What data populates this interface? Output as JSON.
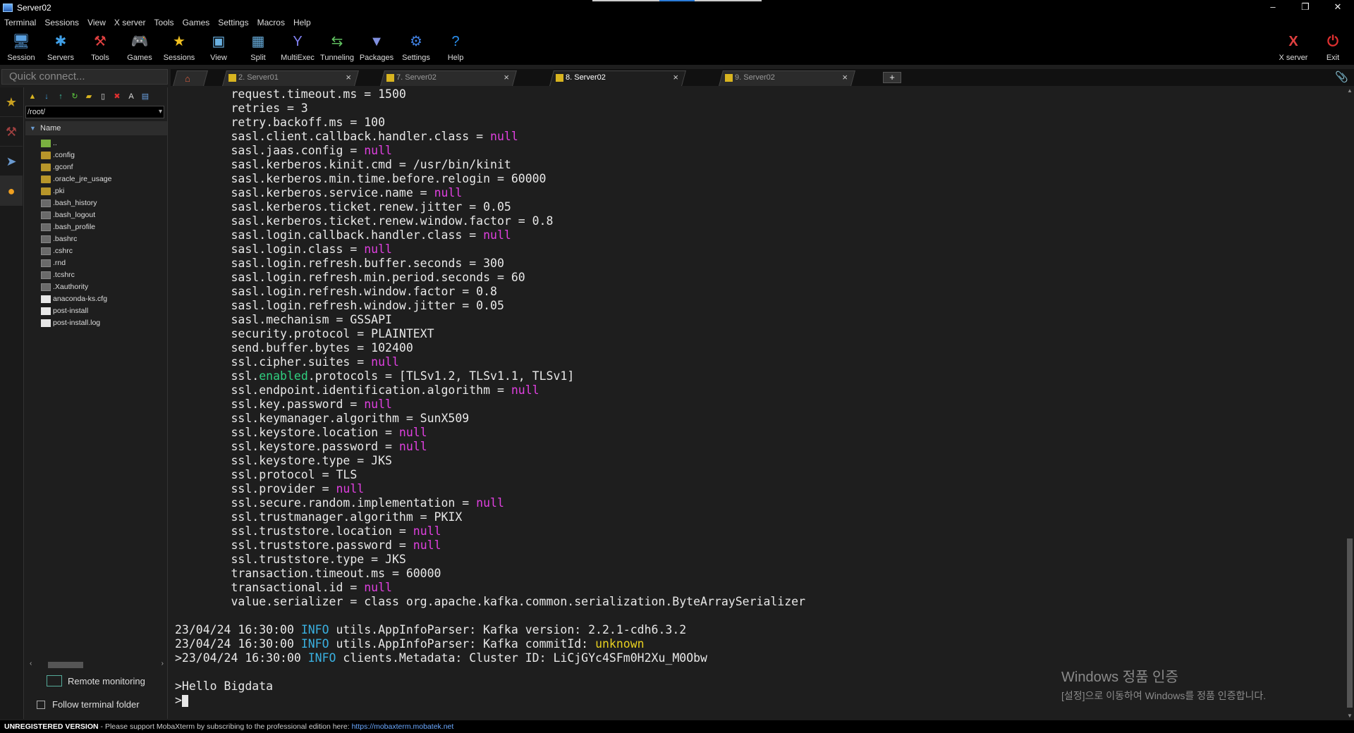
{
  "window": {
    "title": "Server02",
    "controls": [
      "–",
      "❐",
      "✕"
    ]
  },
  "menu": [
    "Terminal",
    "Sessions",
    "View",
    "X server",
    "Tools",
    "Games",
    "Settings",
    "Macros",
    "Help"
  ],
  "toolbar": {
    "items": [
      {
        "label": "Session",
        "icon": "session-icon",
        "glyph": "🖥",
        "color": "#5aa0e0"
      },
      {
        "label": "Servers",
        "icon": "servers-icon",
        "glyph": "✱",
        "color": "#40a0e8"
      },
      {
        "label": "Tools",
        "icon": "tools-icon",
        "glyph": "⚒",
        "color": "#e04040"
      },
      {
        "label": "Games",
        "icon": "games-icon",
        "glyph": "🎮",
        "color": "#ddd"
      },
      {
        "label": "Sessions",
        "icon": "sessions-star-icon",
        "glyph": "★",
        "color": "#f0c020"
      },
      {
        "label": "View",
        "icon": "view-icon",
        "glyph": "▣",
        "color": "#6ab0e0"
      },
      {
        "label": "Split",
        "icon": "split-icon",
        "glyph": "▦",
        "color": "#6ab0e0"
      },
      {
        "label": "MultiExec",
        "icon": "multiexec-icon",
        "glyph": "Y",
        "color": "#8080f0"
      },
      {
        "label": "Tunneling",
        "icon": "tunneling-icon",
        "glyph": "⇆",
        "color": "#60c060"
      },
      {
        "label": "Packages",
        "icon": "packages-icon",
        "glyph": "▼",
        "color": "#8090e0"
      },
      {
        "label": "Settings",
        "icon": "settings-icon",
        "glyph": "⚙",
        "color": "#4080e0"
      },
      {
        "label": "Help",
        "icon": "help-icon",
        "glyph": "?",
        "color": "#2a90f0"
      }
    ],
    "right": [
      {
        "label": "X server",
        "icon": "xserver-icon",
        "glyph": "X",
        "color": "#e04040"
      },
      {
        "label": "Exit",
        "icon": "exit-icon",
        "glyph": "⏻",
        "color": "#e03030"
      }
    ]
  },
  "quick_connect": {
    "placeholder": "Quick connect..."
  },
  "tabs": [
    {
      "label": "2. Server01",
      "active": false
    },
    {
      "label": "7. Server02",
      "active": false
    },
    {
      "label": "8. Server02",
      "active": true
    },
    {
      "label": "9. Server02",
      "active": false
    }
  ],
  "sftp": {
    "path": "/root/",
    "column": "Name",
    "files": [
      {
        "name": "..",
        "kind": "up"
      },
      {
        "name": ".config",
        "kind": "folder"
      },
      {
        "name": ".gconf",
        "kind": "folder"
      },
      {
        "name": ".oracle_jre_usage",
        "kind": "folder"
      },
      {
        "name": ".pki",
        "kind": "folder"
      },
      {
        "name": ".bash_history",
        "kind": "file"
      },
      {
        "name": ".bash_logout",
        "kind": "file"
      },
      {
        "name": ".bash_profile",
        "kind": "file"
      },
      {
        "name": ".bashrc",
        "kind": "file"
      },
      {
        "name": ".cshrc",
        "kind": "file"
      },
      {
        "name": ".rnd",
        "kind": "file"
      },
      {
        "name": ".tcshrc",
        "kind": "file"
      },
      {
        "name": ".Xauthority",
        "kind": "file"
      },
      {
        "name": "anaconda-ks.cfg",
        "kind": "doc"
      },
      {
        "name": "post-install",
        "kind": "doc"
      },
      {
        "name": "post-install.log",
        "kind": "doc"
      }
    ],
    "remote_monitoring": "Remote monitoring",
    "follow_terminal": "Follow terminal folder"
  },
  "terminal_lines": [
    [
      {
        "t": "        request.timeout.ms = 1500"
      }
    ],
    [
      {
        "t": "        retries = 3"
      }
    ],
    [
      {
        "t": "        retry.backoff.ms = 100"
      }
    ],
    [
      {
        "t": "        sasl.client.callback.handler.class = "
      },
      {
        "t": "null",
        "c": "null"
      }
    ],
    [
      {
        "t": "        sasl.jaas.config = "
      },
      {
        "t": "null",
        "c": "null"
      }
    ],
    [
      {
        "t": "        sasl.kerberos.kinit.cmd = /usr/bin/kinit"
      }
    ],
    [
      {
        "t": "        sasl.kerberos.min.time.before.relogin = 60000"
      }
    ],
    [
      {
        "t": "        sasl.kerberos.service.name = "
      },
      {
        "t": "null",
        "c": "null"
      }
    ],
    [
      {
        "t": "        sasl.kerberos.ticket.renew.jitter = 0.05"
      }
    ],
    [
      {
        "t": "        sasl.kerberos.ticket.renew.window.factor = 0.8"
      }
    ],
    [
      {
        "t": "        sasl.login.callback.handler.class = "
      },
      {
        "t": "null",
        "c": "null"
      }
    ],
    [
      {
        "t": "        sasl.login.class = "
      },
      {
        "t": "null",
        "c": "null"
      }
    ],
    [
      {
        "t": "        sasl.login.refresh.buffer.seconds = 300"
      }
    ],
    [
      {
        "t": "        sasl.login.refresh.min.period.seconds = 60"
      }
    ],
    [
      {
        "t": "        sasl.login.refresh.window.factor = 0.8"
      }
    ],
    [
      {
        "t": "        sasl.login.refresh.window.jitter = 0.05"
      }
    ],
    [
      {
        "t": "        sasl.mechanism = GSSAPI"
      }
    ],
    [
      {
        "t": "        security.protocol = PLAINTEXT"
      }
    ],
    [
      {
        "t": "        send.buffer.bytes = 102400"
      }
    ],
    [
      {
        "t": "        ssl.cipher.suites = "
      },
      {
        "t": "null",
        "c": "null"
      }
    ],
    [
      {
        "t": "        ssl."
      },
      {
        "t": "enabled",
        "c": "grn"
      },
      {
        "t": ".protocols = [TLSv1.2, TLSv1.1, TLSv1]"
      }
    ],
    [
      {
        "t": "        ssl.endpoint.identification.algorithm = "
      },
      {
        "t": "null",
        "c": "null"
      }
    ],
    [
      {
        "t": "        ssl.key.password = "
      },
      {
        "t": "null",
        "c": "null"
      }
    ],
    [
      {
        "t": "        ssl.keymanager.algorithm = SunX509"
      }
    ],
    [
      {
        "t": "        ssl.keystore.location = "
      },
      {
        "t": "null",
        "c": "null"
      }
    ],
    [
      {
        "t": "        ssl.keystore.password = "
      },
      {
        "t": "null",
        "c": "null"
      }
    ],
    [
      {
        "t": "        ssl.keystore.type = JKS"
      }
    ],
    [
      {
        "t": "        ssl.protocol = TLS"
      }
    ],
    [
      {
        "t": "        ssl.provider = "
      },
      {
        "t": "null",
        "c": "null"
      }
    ],
    [
      {
        "t": "        ssl.secure.random.implementation = "
      },
      {
        "t": "null",
        "c": "null"
      }
    ],
    [
      {
        "t": "        ssl.trustmanager.algorithm = PKIX"
      }
    ],
    [
      {
        "t": "        ssl.truststore.location = "
      },
      {
        "t": "null",
        "c": "null"
      }
    ],
    [
      {
        "t": "        ssl.truststore.password = "
      },
      {
        "t": "null",
        "c": "null"
      }
    ],
    [
      {
        "t": "        ssl.truststore.type = JKS"
      }
    ],
    [
      {
        "t": "        transaction.timeout.ms = 60000"
      }
    ],
    [
      {
        "t": "        transactional.id = "
      },
      {
        "t": "null",
        "c": "null"
      }
    ],
    [
      {
        "t": "        value.serializer = class org.apache.kafka.common.serialization.ByteArraySerializer"
      }
    ],
    [
      {
        "t": ""
      }
    ],
    [
      {
        "t": "23/04/24 16:30:00 "
      },
      {
        "t": "INFO",
        "c": "info"
      },
      {
        "t": " utils.AppInfoParser: Kafka version: 2.2.1-cdh6.3.2"
      }
    ],
    [
      {
        "t": "23/04/24 16:30:00 "
      },
      {
        "t": "INFO",
        "c": "info"
      },
      {
        "t": " utils.AppInfoParser: Kafka commitId: "
      },
      {
        "t": "unknown",
        "c": "yel"
      }
    ],
    [
      {
        "t": ">23/04/24 16:30:00 "
      },
      {
        "t": "INFO",
        "c": "info"
      },
      {
        "t": " clients.Metadata: Cluster ID: LiCjGYc4SFm0H2Xu_M0Obw"
      }
    ],
    [
      {
        "t": ""
      }
    ],
    [
      {
        "t": ">Hello Bigdata"
      }
    ],
    [
      {
        "t": ">"
      },
      {
        "cursor": true
      }
    ]
  ],
  "watermark": {
    "line1": "Windows 정품 인증",
    "line2": "[설정]으로 이동하여 Windows를 정품 인증합니다."
  },
  "status": {
    "badge": "UNREGISTERED VERSION",
    "text": " -  Please support MobaXterm by subscribing to the professional edition here:  ",
    "link": "https://mobaxterm.mobatek.net"
  }
}
